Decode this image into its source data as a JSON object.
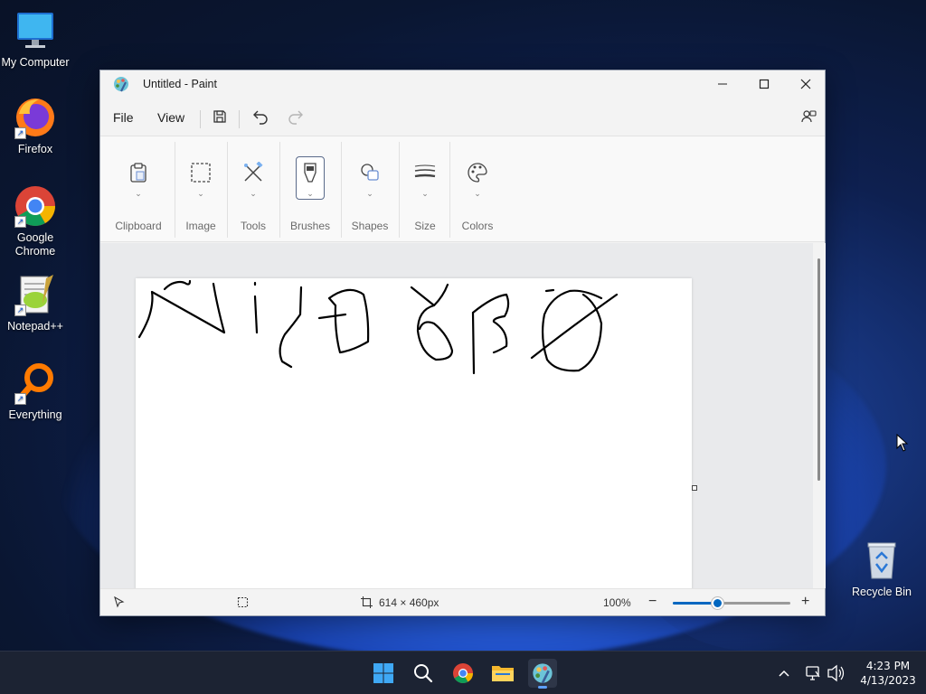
{
  "desktop": {
    "icons": [
      {
        "label": "My Computer"
      },
      {
        "label": "Firefox"
      },
      {
        "label": "Google Chrome"
      },
      {
        "label": "Notepad++"
      },
      {
        "label": "Everything"
      },
      {
        "label": "Recycle Bin"
      }
    ]
  },
  "window": {
    "title": "Untitled - Paint",
    "menu": {
      "file": "File",
      "view": "View"
    },
    "toolbar": {
      "save": "save-icon",
      "undo": "undo-icon",
      "redo": "redo-icon"
    },
    "ribbon": {
      "groups": [
        {
          "label": "Clipboard",
          "icon": "clipboard-icon"
        },
        {
          "label": "Image",
          "icon": "selection-icon"
        },
        {
          "label": "Tools",
          "icon": "tools-icon"
        },
        {
          "label": "Brushes",
          "icon": "brush-icon",
          "active": true
        },
        {
          "label": "Shapes",
          "icon": "shapes-icon"
        },
        {
          "label": "Size",
          "icon": "size-icon"
        },
        {
          "label": "Colors",
          "icon": "palette-icon"
        }
      ]
    },
    "status": {
      "canvas_size": "614 × 460px",
      "zoom": "100%",
      "zoom_fraction": 0.38
    }
  },
  "taskbar": {
    "time": "4:23 PM",
    "date": "4/13/2023"
  },
  "colors": {
    "accent": "#0067c0",
    "taskbar": "#1c2333"
  }
}
